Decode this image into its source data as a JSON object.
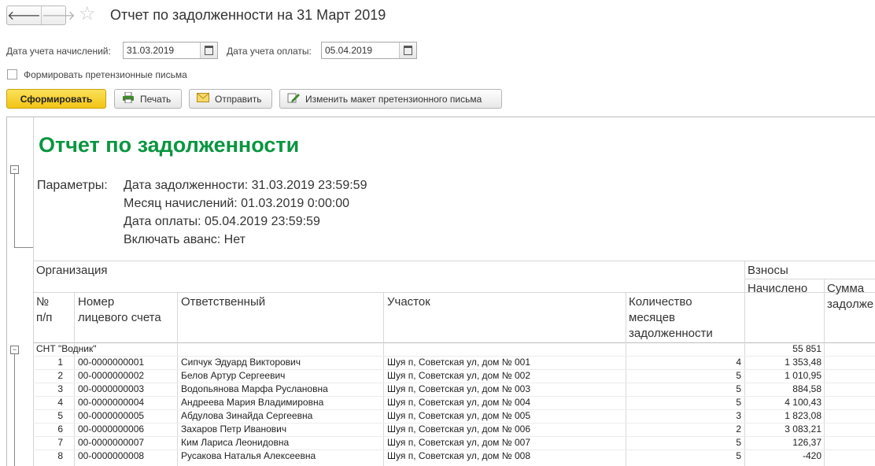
{
  "window": {
    "title": "Отчет по задолженности на 31 Март 2019"
  },
  "nav": {
    "back": "🡐",
    "forward": "🡒",
    "favorite": "☆"
  },
  "form": {
    "accrual_date_label": "Дата учета начислений:",
    "accrual_date_value": "31.03.2019",
    "payment_date_label": "Дата учета оплаты:",
    "payment_date_value": "05.04.2019",
    "claim_letters_label": "Формировать претензионные письма",
    "claim_letters_checked": false
  },
  "toolbar": {
    "generate": "Сформировать",
    "print": "Печать",
    "send": "Отправить",
    "edit_layout": "Изменить макет претензионного письма"
  },
  "report": {
    "title": "Отчет по задолженности",
    "params_label": "Параметры:",
    "params": [
      "Дата задолженности: 31.03.2019 23:59:59",
      "Месяц начислений: 01.03.2019 0:00:00",
      "Дата оплаты: 05.04.2019 23:59:59",
      "Включать аванс: Нет"
    ],
    "headers": {
      "organization": "Организация",
      "contributions": "Взносы",
      "accrued": "Начислено",
      "debt_amount": "Сумма задолже",
      "num_line1": "№",
      "num_line2": "п/п",
      "account_line1": "Номер",
      "account_line2": "лицевого счета",
      "responsible": "Ответственный",
      "plot": "Участок",
      "months_line1": "Количество",
      "months_line2": "месяцев",
      "months_line3": "задолженности"
    },
    "group": {
      "name": "СНТ \"Водник\"",
      "accrued": "55 851"
    },
    "rows": [
      {
        "n": "1",
        "account": "00-0000000001",
        "person": "Сипчук Эдуард Викторович",
        "plot": "Шуя п, Советская ул, дом № 001",
        "months": "4",
        "accrued": "1 353,48"
      },
      {
        "n": "2",
        "account": "00-0000000002",
        "person": "Белов Артур Сергеевич",
        "plot": "Шуя п, Советская ул, дом № 002",
        "months": "5",
        "accrued": "1 010,95"
      },
      {
        "n": "3",
        "account": "00-0000000003",
        "person": "Водопьянова Марфа Руслановна",
        "plot": "Шуя п, Советская ул, дом № 003",
        "months": "5",
        "accrued": "884,58"
      },
      {
        "n": "4",
        "account": "00-0000000004",
        "person": "Андреева Мария Владимировна",
        "plot": "Шуя п, Советская ул, дом № 004",
        "months": "5",
        "accrued": "4 100,43"
      },
      {
        "n": "5",
        "account": "00-0000000005",
        "person": "Абдулова Зинайда Сергеевна",
        "plot": "Шуя п, Советская ул, дом № 005",
        "months": "3",
        "accrued": "1 823,08"
      },
      {
        "n": "6",
        "account": "00-0000000006",
        "person": "Захаров Петр Иванович",
        "plot": "Шуя п, Советская ул, дом № 006",
        "months": "2",
        "accrued": "3 083,21"
      },
      {
        "n": "7",
        "account": "00-0000000007",
        "person": "Ким Лариса Леонидовна",
        "plot": "Шуя п, Советская ул, дом № 007",
        "months": "5",
        "accrued": "126,37"
      },
      {
        "n": "8",
        "account": "00-0000000008",
        "person": "Русакова Наталья Алексеевна",
        "plot": "Шуя п, Советская ул, дом № 008",
        "months": "5",
        "accrued": "-420"
      }
    ]
  },
  "colors": {
    "title_green": "#0a9640",
    "primary_button": "#f5cc22"
  }
}
